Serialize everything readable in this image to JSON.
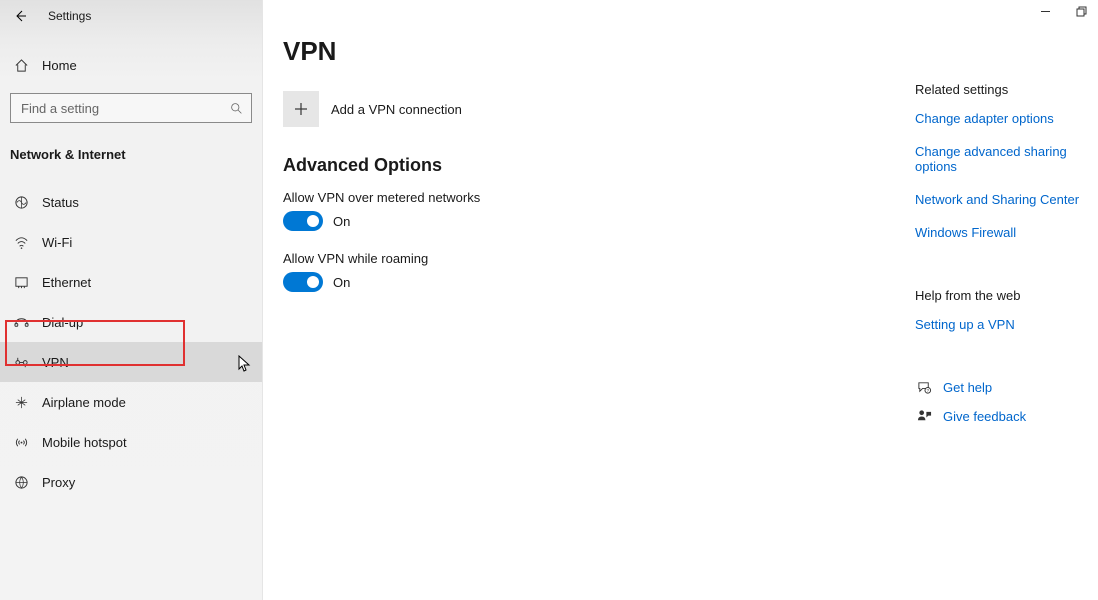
{
  "header": {
    "title": "Settings"
  },
  "sidebar": {
    "home": "Home",
    "search_placeholder": "Find a setting",
    "category": "Network & Internet",
    "items": [
      {
        "label": "Status"
      },
      {
        "label": "Wi-Fi"
      },
      {
        "label": "Ethernet"
      },
      {
        "label": "Dial-up"
      },
      {
        "label": "VPN"
      },
      {
        "label": "Airplane mode"
      },
      {
        "label": "Mobile hotspot"
      },
      {
        "label": "Proxy"
      }
    ]
  },
  "main": {
    "title": "VPN",
    "add_label": "Add a VPN connection",
    "section": "Advanced Options",
    "setting1_label": "Allow VPN over metered networks",
    "setting1_state": "On",
    "setting2_label": "Allow VPN while roaming",
    "setting2_state": "On"
  },
  "right": {
    "related_heading": "Related settings",
    "links": {
      "adapter": "Change adapter options",
      "sharing": "Change advanced sharing options",
      "center": "Network and Sharing Center",
      "firewall": "Windows Firewall"
    },
    "help_heading": "Help from the web",
    "help_link": "Setting up a VPN",
    "get_help": "Get help",
    "give_feedback": "Give feedback"
  }
}
